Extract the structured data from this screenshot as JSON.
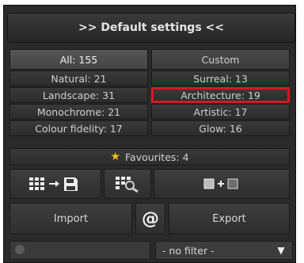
{
  "header": {
    "title": ">> Default settings <<"
  },
  "categories": {
    "all": "All: 155",
    "custom": "Custom",
    "natural": "Natural: 21",
    "surreal": "Surreal: 13",
    "landscape": "Landscape: 31",
    "architecture": "Architecture: 19",
    "monochrome": "Monochrome: 21",
    "artistic": "Artistic: 17",
    "colour_fidelity": "Colour fidelity: 17",
    "glow": "Glow: 16"
  },
  "favourites": {
    "label": "Favourites: 4"
  },
  "actions": {
    "import_label": "Import",
    "export_label": "Export",
    "at_symbol": "@"
  },
  "filter": {
    "selected": "- no filter -"
  },
  "colors": {
    "highlight": "#d9181d",
    "star": "#f2c21a"
  }
}
